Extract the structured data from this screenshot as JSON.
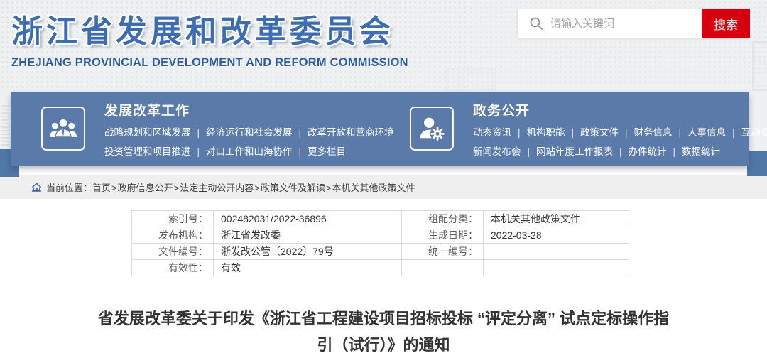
{
  "header": {
    "site_title": "浙江省发展和改革委员会",
    "site_subtitle": "ZHEJIANG PROVINCIAL DEVELOPMENT AND REFORM COMMISSION",
    "search": {
      "placeholder": "请输入关键词",
      "button_label": "搜索"
    }
  },
  "nav": {
    "sections": [
      {
        "title": "发展改革工作",
        "icon": "people-group-icon",
        "lines": [
          {
            "items": [
              "战略规划和区域发展",
              "经济运行和社会发展",
              "改革开放和营商环境"
            ],
            "trailing_separator": false
          },
          {
            "items": [
              "投资管理和项目推进",
              "对口工作和山海协作",
              "更多栏目"
            ],
            "trailing_separator": false
          }
        ]
      },
      {
        "title": "政务公开",
        "icon": "person-gear-icon",
        "lines": [
          {
            "items": [
              "动态资讯",
              "机构职能",
              "政策文件",
              "财务信息",
              "人事信息",
              "互动交流"
            ],
            "trailing_separator": true
          },
          {
            "items": [
              "新闻发布会",
              "网站年度工作报表",
              "办件统计",
              "数据统计"
            ],
            "trailing_separator": false
          }
        ]
      }
    ]
  },
  "breadcrumb": {
    "label": "当前位置：",
    "segments": [
      "首页",
      "政府信息公开",
      "法定主动公开内容",
      "政策文件及解读",
      "本机关其他政策文件"
    ]
  },
  "meta_table": {
    "rows": [
      {
        "label1": "索引号：",
        "value1": "002482031/2022-36896",
        "label2": "组配分类：",
        "value2": "本机关其他政策文件"
      },
      {
        "label1": "发布机构：",
        "value1": "浙江省发改委",
        "label2": "生成日期：",
        "value2": "2022-03-28"
      },
      {
        "label1": "文件编号：",
        "value1": "浙发改公管〔2022〕79号",
        "label2": "统一编号：",
        "value2": ""
      },
      {
        "label1": "有效性：",
        "value1": "有效",
        "label2": "",
        "value2": ""
      }
    ]
  },
  "document": {
    "title": "省发展改革委关于印发《浙江省工程建设项目招标投标 “评定分离” 试点定标操作指引（试行）》的通知"
  },
  "colors": {
    "band_blue": "#5a7aa9",
    "title_blue": "#3c6cb4",
    "accent_red": "#d6000f",
    "breadcrumb_bg": "#efefef",
    "header_bg": "#eef0f2"
  }
}
